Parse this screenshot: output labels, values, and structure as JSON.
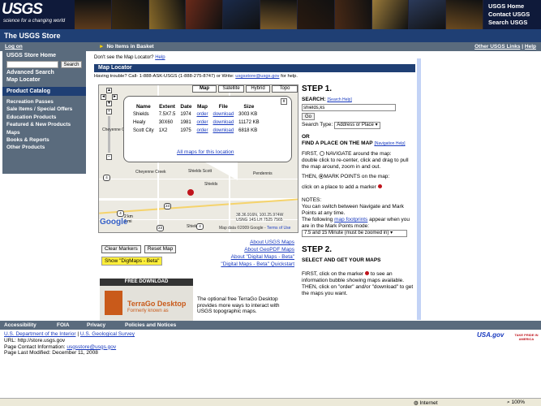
{
  "header": {
    "logo_text": "USGS",
    "logo_tagline": "science for a changing world",
    "links": [
      "USGS Home",
      "Contact USGS",
      "Search USGS"
    ],
    "photo_colors": [
      "#5b3a1c",
      "#3b2a12",
      "#8a6b2a",
      "#6a2a1a",
      "#1a2a4a",
      "#7a5a2a",
      "#2a1a10",
      "#4a2a16",
      "#9a7a3a",
      "#2b3a5a",
      "#6b4a20"
    ]
  },
  "store_title": "The USGS Store",
  "navbar": {
    "login": "Log on",
    "basket": "No Items in Basket",
    "other_links": "Other USGS Links",
    "separator": "|",
    "help": "Help"
  },
  "sidebar": {
    "home": "USGS Store Home",
    "search_button": "Search",
    "advanced": "Advanced Search",
    "map_locator": "Map Locator",
    "catalog_header": "Product Catalog",
    "items": [
      "Recreation Passes",
      "Sale Items / Special Offers",
      "Education Products",
      "Featured & New Products",
      "Maps",
      "Books & Reports",
      "Other Products"
    ]
  },
  "main": {
    "question": "Don't see the Map Locator?",
    "question_help": "Help",
    "locator_header": "Map Locator",
    "help_text": "Having trouble? Call- 1-888-ASK-USGS (1-888-275-8747) or Write:",
    "help_email": "usgsstore@usgs.gov",
    "help_suffix": "for help."
  },
  "map": {
    "types": [
      "Map",
      "Satellite",
      "Hybrid",
      "Topo"
    ],
    "labels": [
      "Cheyenne Creek",
      "Cheyenne Creek",
      "Shields Scott",
      "Shields",
      "Pendennis",
      "Shields"
    ],
    "shields": [
      "4",
      "4",
      "23",
      "23",
      "4"
    ],
    "scale_km": "2 km",
    "scale_mi": "1 mi",
    "coords_line1": "38.36.916N, 100.25.974W",
    "coords_line2": "USNG 14S LH 7525 7565",
    "copyright": "Map data ©2009 Google -",
    "terms": "Terms of Use",
    "google": "Google",
    "marker_color": "#c0141c"
  },
  "popup": {
    "headers": [
      "Name",
      "Extent",
      "Date",
      "Map",
      "File",
      "Size"
    ],
    "rows": [
      {
        "name": "Shields",
        "extent": "7.5X7.5",
        "date": "1974",
        "map": "order",
        "file": "download",
        "size": "3003 KB"
      },
      {
        "name": "Healy",
        "extent": "30X60",
        "date": "1981",
        "map": "order",
        "file": "download",
        "size": "11172 KB"
      },
      {
        "name": "Scott City",
        "extent": "1X2",
        "date": "1975",
        "map": "order",
        "file": "download",
        "size": "6818 KB"
      }
    ],
    "all_maps": "All maps for this location",
    "close": "x"
  },
  "buttons": {
    "clear_markers": "Clear Markers",
    "reset_map": "Reset Map",
    "digimaps": "Show \"DigMaps - Beta\""
  },
  "map_links": [
    "About USGS Maps",
    "About GeoPDF Maps",
    "About \"Digital Maps - Beta\"",
    "\"Digital Maps - Beta\" Quickstart"
  ],
  "terrago": {
    "free_download": "FREE DOWNLOAD",
    "name": "TerraGo Desktop",
    "formerly": "Formerly known as",
    "description": "The optional free TerraGo Desktop provides more ways to interact with USGS topographic maps."
  },
  "step1": {
    "title": "STEP 1.",
    "search_label": "SEARCH:",
    "search_help": "[Search Help]",
    "search_value": "shields,ks",
    "go": "Go",
    "search_type_label": "Search Type:",
    "search_type_value": "Address or Place",
    "or": "OR",
    "find_place": "FIND A PLACE ON THE MAP",
    "nav_help": "[Navigation Help]",
    "first_label": "FIRST,",
    "navigate": "NAVIGATE around the map:",
    "navigate_desc": "double click to re-center, click and drag to pull the map around, zoom in and out.",
    "then_label": "THEN,",
    "mark_points": "MARK POINTS on the map:",
    "mark_desc": "click on a place to add a marker",
    "notes_label": "NOTES:",
    "notes_text": "You can switch between Navigate and Mark Points at any time.",
    "notes_text2_a": "The following",
    "footprints": "map footprints",
    "notes_text2_b": "appear when you are in the Mark Points mode:",
    "mode_value": "7.5 and 15 Minute (must be zoomed in)"
  },
  "step2": {
    "title": "STEP 2.",
    "subtitle": "SELECT AND GET YOUR MAPS",
    "first": "FIRST, click on the marker",
    "first_b": "to see an information bubble showing maps available.",
    "then": "THEN, click on \"order\" and/or \"download\" to get the maps you want."
  },
  "footer_bar": [
    "Accessibility",
    "FOIA",
    "Privacy",
    "Policies and Notices"
  ],
  "footer": {
    "doi": "U.S. Department of the Interior",
    "sep": "|",
    "usgs": "U.S. Geological Survey",
    "url": "URL: http://store.usgs.gov",
    "contact_label": "Page Contact Information:",
    "contact_email": "usgsstore@usgs.gov",
    "modified": "Page Last Modified: December 11, 2008",
    "usagov": "USA.gov",
    "take_pride": "TAKE PRIDE IN AMERICA"
  },
  "status": {
    "zone": "Internet",
    "zoom": "100%"
  }
}
